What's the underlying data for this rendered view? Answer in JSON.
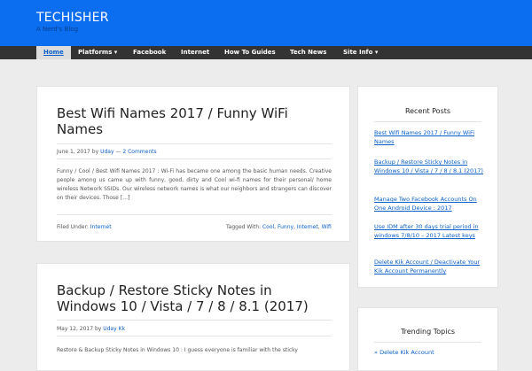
{
  "site": {
    "title": "TECHISHER",
    "description": "A Nerd's Blog"
  },
  "nav": {
    "items": [
      "Home",
      "Platforms ▾",
      "Facebook",
      "Internet",
      "How To Guides",
      "Tech News",
      "Site Info ▾"
    ],
    "active": "Home"
  },
  "posts": [
    {
      "title": "Best Wifi Names 2017 / Funny WiFi Names",
      "date": "June 1, 2017",
      "by": "by",
      "author": "Uday",
      "dash": "—",
      "comments": "2 Comments",
      "excerpt": "Funny / Cool / Best Wifi Names 2017 : Wi-Fi has became one among the basic human needs. Creative people among us came up with funny, good, dirty and Cool wi-fi names for their personal/ home wireless Network SSIDs.  Our wireless network names is what our neighbors and strangers can discover on their devices. Those […]",
      "filed_under_label": "Filed Under:",
      "category": "Internet",
      "tagged_with_label": "Tagged With:",
      "tags": [
        "Cool",
        "Funny",
        "Internet",
        "Wifi"
      ]
    },
    {
      "title": "Backup / Restore Sticky Notes in Windows 10 / Vista / 7 / 8 / 8.1 (2017)",
      "date": "May 12, 2017",
      "by": "by",
      "author": "Uday Kk",
      "excerpt": "Restore & Backup Sticky Notes in Windows 10 : I guess everyone is familiar with the sticky"
    }
  ],
  "sidebar": {
    "recent_posts": {
      "title": "Recent Posts",
      "items": [
        "Best Wifi Names 2017 / Funny WiFi Names",
        "Backup / Restore Sticky Notes in Windows 10 / Vista / 7 / 8 / 8.1 (2017)",
        "Manage Two Facebook Accounts On One Android Device : 2017",
        "Use IDM after 30 days trial period in windows 7/8/10 – 2017 Latest keys",
        "Delete Kik Account / Deactivate Your Kik Account Permanently"
      ]
    },
    "trending": {
      "title": "Trending Topics",
      "items": [
        "Delete Kik Account"
      ]
    }
  },
  "colors": {
    "header": "#0b6ef0",
    "nav": "#333333",
    "link": "#0a5fc9",
    "background": "#ececec"
  }
}
